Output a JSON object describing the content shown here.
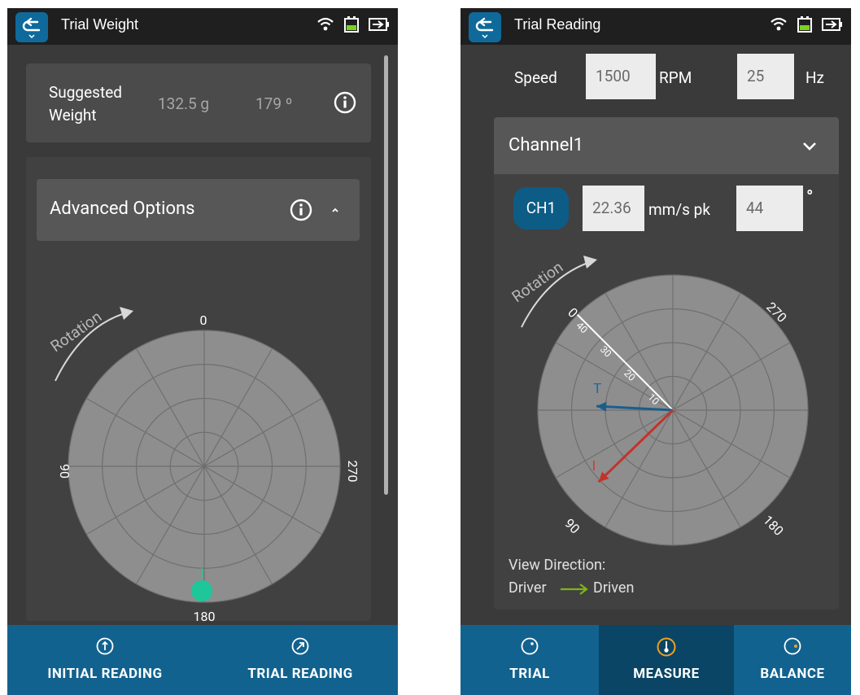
{
  "left": {
    "title": "Trial Weight",
    "suggested_label": "Suggested\nWeight",
    "suggested_weight": "132.5 g",
    "suggested_angle": "179 º",
    "advanced_label": "Advanced Options",
    "rotation_label": "Rotation",
    "polar_labels": {
      "top": "0",
      "left": "90",
      "right": "270",
      "bottom": "180"
    },
    "weight_marker_angle_deg": 179,
    "nav": [
      {
        "label": "INITIAL READING"
      },
      {
        "label": "TRIAL READING"
      }
    ]
  },
  "right": {
    "title": "Trial Reading",
    "speed_label": "Speed",
    "speed_rpm": "1500",
    "rpm_unit": "RPM",
    "speed_hz": "25",
    "hz_unit": "Hz",
    "channel_title": "Channel1",
    "ch_chip": "CH1",
    "amplitude": "22.36",
    "amplitude_unit": "mm/s pk",
    "phase": "44",
    "phase_unit": "°",
    "rotation_label": "Rotation",
    "polar_labels": {
      "zero": "0",
      "a270": "270",
      "a90": "90",
      "a180": "180"
    },
    "scale_labels": [
      "40",
      "30",
      "20",
      "10"
    ],
    "vector_t_label": "T",
    "vector_i_label": "I",
    "view_direction_label": "View Direction:",
    "driver_label": "Driver",
    "driven_label": "Driven",
    "nav": [
      {
        "label": "TRIAL"
      },
      {
        "label": "MEASURE"
      },
      {
        "label": "BALANCE"
      }
    ]
  },
  "colors": {
    "accent": "#0f6a9b",
    "nav_bg": "#12628f",
    "nav_active": "#0a4565",
    "marker_green": "#1ec79a",
    "vector_blue": "#1a5e8c",
    "vector_red": "#c2342b",
    "arrow_green": "#7cb518"
  }
}
